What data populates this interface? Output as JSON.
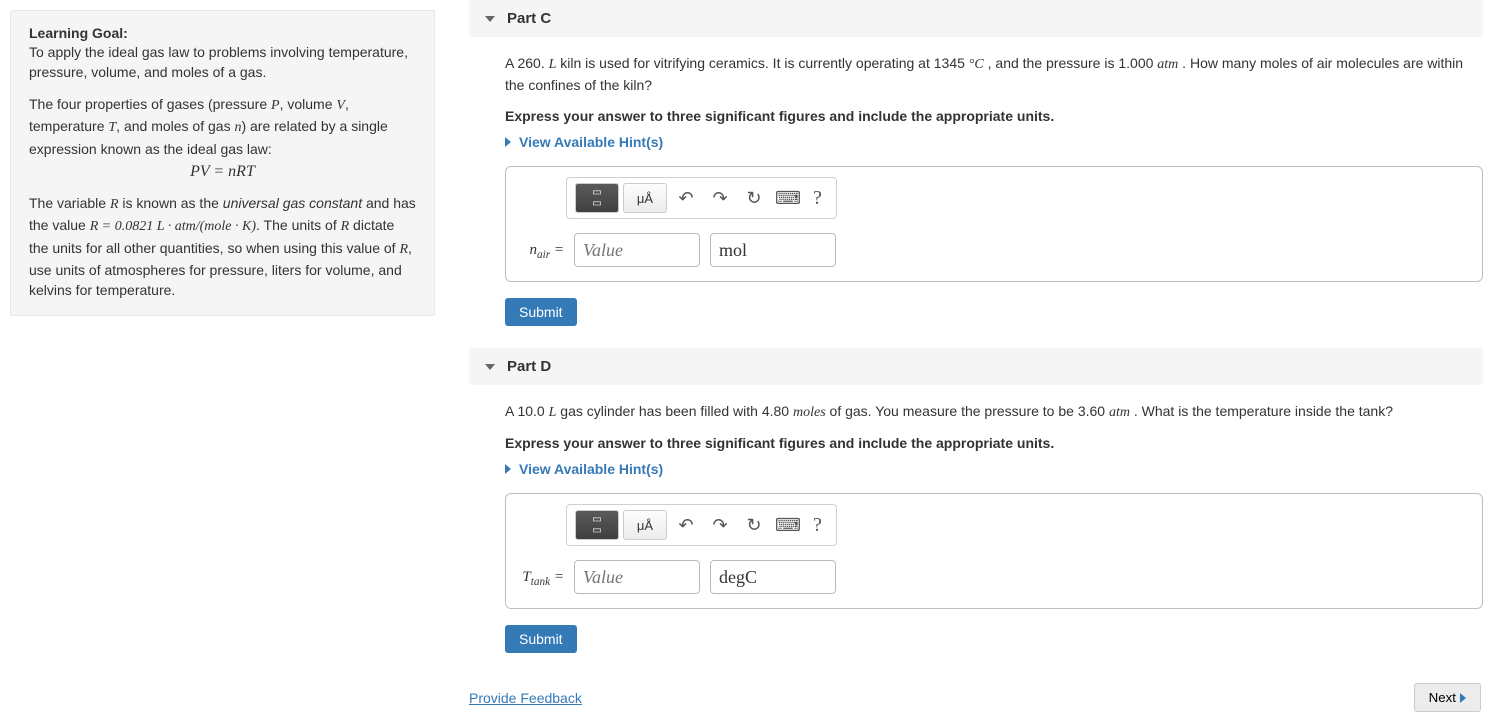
{
  "goal": {
    "title": "Learning Goal:",
    "text1": "To apply the ideal gas law to problems involving temperature, pressure, volume, and moles of a gas.",
    "text2a": "The four properties of gases (pressure ",
    "text2b": ", volume ",
    "text2c": ", temperature ",
    "text2d": ", and moles of gas ",
    "text2e": ") are related by a single expression known as the ideal gas law:",
    "formula": "PV = nRT",
    "text3a": "The variable ",
    "text3b": " is known as the ",
    "text3c": "universal gas constant",
    "text3d": " and has the value ",
    "text3e": ". The units of ",
    "text3f": " dictate the units for all other quantities, so when using this value of ",
    "text3g": ", use units of atmospheres for pressure, liters for volume, and kelvins for temperature.",
    "rvalue": "R = 0.0821 L · atm/(mole · K)"
  },
  "partC": {
    "title": "Part C",
    "q1": "A 260. ",
    "qL": "L",
    "q2": " kiln is used for vitrifying ceramics. It is currently operating at 1345 ",
    "qDegC": "°C",
    "q3": " , and the pressure is 1.000 ",
    "qAtm": "atm",
    "q4": " . How many moles of air molecules are within the confines of the kiln?",
    "instruction": "Express your answer to three significant figures and include the appropriate units.",
    "hints": "View Available Hint(s)",
    "varlabel": "nair",
    "eq": "=",
    "placeholder": "Value",
    "unit": "mol",
    "submit": "Submit"
  },
  "partD": {
    "title": "Part D",
    "q1": "A 10.0 ",
    "qL": "L",
    "q2": " gas cylinder has been filled with 4.80 ",
    "qMoles": "moles",
    "q3": " of gas. You measure the pressure to be 3.60 ",
    "qAtm": "atm",
    "q4": " . What is the temperature inside the tank?",
    "instruction": "Express your answer to three significant figures and include the appropriate units.",
    "hints": "View Available Hint(s)",
    "varlabel": "Ttank",
    "eq": "=",
    "placeholder": "Value",
    "unit": "degC",
    "submit": "Submit"
  },
  "toolbar": {
    "units": "μÅ"
  },
  "footer": {
    "feedback": "Provide Feedback",
    "next": "Next"
  }
}
